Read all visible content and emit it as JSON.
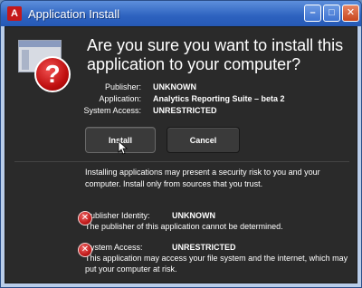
{
  "window": {
    "title": "Application Install",
    "logo_glyph": "A",
    "buttons": {
      "minimize": "–",
      "maximize": "□",
      "close": "✕"
    }
  },
  "dialog": {
    "question": "Are you sure you want to install this application to your computer?",
    "icon": "question-icon",
    "info": [
      {
        "label": "Publisher:",
        "value": "UNKNOWN"
      },
      {
        "label": "Application:",
        "value": "Analytics Reporting Suite – beta 2"
      },
      {
        "label": "System Access:",
        "value": "UNRESTRICTED"
      }
    ],
    "buttons": {
      "install": "Install",
      "cancel": "Cancel"
    },
    "warning": "Installing applications may present a security risk to you and your computer. Install only from sources that you trust.",
    "risks": [
      {
        "label": "Publisher Identity:",
        "value": "UNKNOWN",
        "description": "The publisher of this application cannot be determined."
      },
      {
        "label": "System Access:",
        "value": "UNRESTRICTED",
        "description": "This application may access your file system and the internet, which may put your computer at risk."
      }
    ]
  },
  "colors": {
    "title_bar": "#2d62bf",
    "dialog_bg": "#2a2a2a",
    "warning_icon": "#c21b1b"
  }
}
